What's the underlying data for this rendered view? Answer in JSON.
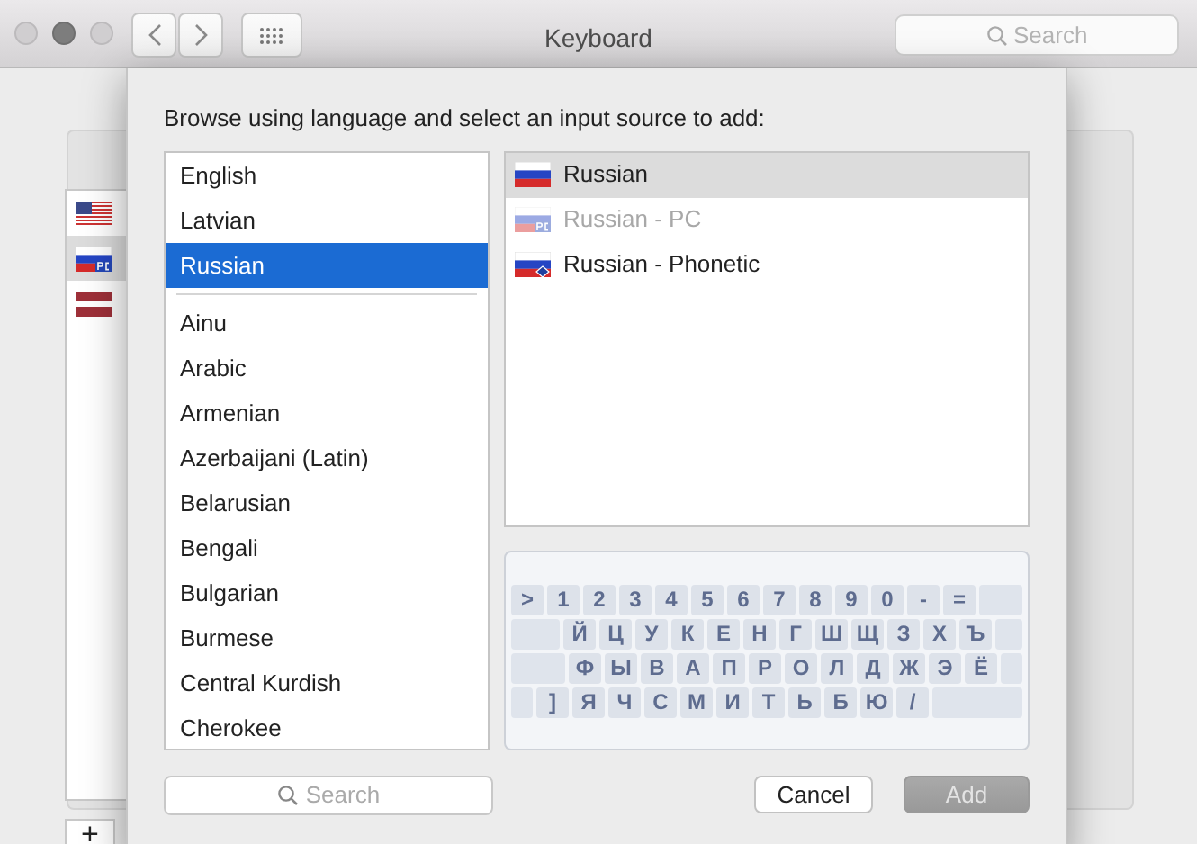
{
  "window": {
    "title": "Keyboard",
    "search": {
      "placeholder": "Search"
    }
  },
  "background_sources": [
    {
      "kind": "us",
      "selected": false
    },
    {
      "kind": "ru-pc",
      "selected": true
    },
    {
      "kind": "lv",
      "selected": false
    }
  ],
  "background_add": "+",
  "sheet": {
    "prompt": "Browse using language and select an input source to add:",
    "preferred_languages": [
      {
        "label": "English",
        "selected": false
      },
      {
        "label": "Latvian",
        "selected": false
      },
      {
        "label": "Russian",
        "selected": true
      }
    ],
    "languages": [
      {
        "label": "Ainu",
        "selected": false
      },
      {
        "label": "Arabic",
        "selected": false
      },
      {
        "label": "Armenian",
        "selected": false
      },
      {
        "label": "Azerbaijani (Latin)",
        "selected": false
      },
      {
        "label": "Belarusian",
        "selected": false
      },
      {
        "label": "Bengali",
        "selected": false
      },
      {
        "label": "Bulgarian",
        "selected": false
      },
      {
        "label": "Burmese",
        "selected": false
      },
      {
        "label": "Central Kurdish",
        "selected": false
      },
      {
        "label": "Cherokee",
        "selected": false
      }
    ],
    "input_sources": [
      {
        "label": "Russian",
        "kind": "ru",
        "selected": true,
        "disabled": false
      },
      {
        "label": "Russian - PC",
        "kind": "ru-pc",
        "selected": false,
        "disabled": true
      },
      {
        "label": "Russian - Phonetic",
        "kind": "ru-phonetic",
        "selected": false,
        "disabled": false
      }
    ],
    "keyboard_rows": [
      [
        ">",
        "1",
        "2",
        "3",
        "4",
        "5",
        "6",
        "7",
        "8",
        "9",
        "0",
        "-",
        "="
      ],
      [
        "Й",
        "Ц",
        "У",
        "К",
        "Е",
        "Н",
        "Г",
        "Ш",
        "Щ",
        "З",
        "Х",
        "Ъ"
      ],
      [
        "Ф",
        "Ы",
        "В",
        "А",
        "П",
        "Р",
        "О",
        "Л",
        "Д",
        "Ж",
        "Э",
        "Ё"
      ],
      [
        "]",
        "Я",
        "Ч",
        "С",
        "М",
        "И",
        "Т",
        "Ь",
        "Б",
        "Ю",
        "/"
      ]
    ],
    "search": {
      "placeholder": "Search"
    },
    "buttons": [
      {
        "label": "Cancel",
        "kind": "default"
      },
      {
        "label": "Add",
        "kind": "primary",
        "disabled": true
      }
    ]
  }
}
